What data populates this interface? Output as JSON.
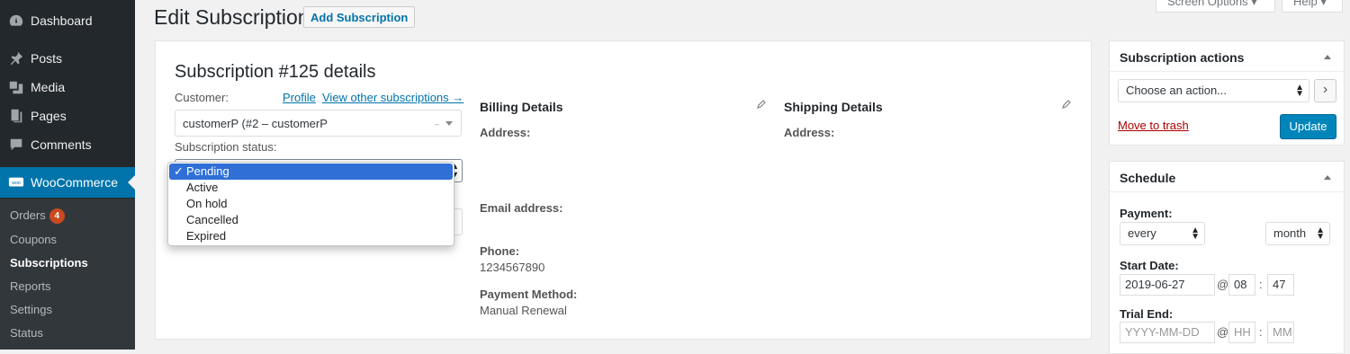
{
  "sidebar": {
    "items": [
      {
        "label": "Dashboard",
        "icon": "dashboard-icon"
      },
      {
        "label": "Posts",
        "icon": "pin-icon"
      },
      {
        "label": "Media",
        "icon": "media-icon"
      },
      {
        "label": "Pages",
        "icon": "pages-icon"
      },
      {
        "label": "Comments",
        "icon": "comments-icon"
      },
      {
        "label": "WooCommerce",
        "icon": "woocommerce-icon"
      }
    ],
    "submenu": [
      {
        "label": "Orders",
        "badge": "4"
      },
      {
        "label": "Coupons"
      },
      {
        "label": "Subscriptions"
      },
      {
        "label": "Reports"
      },
      {
        "label": "Settings"
      },
      {
        "label": "Status"
      }
    ]
  },
  "header": {
    "title": "Edit Subscription",
    "add_button": "Add Subscription",
    "screen_options": "Screen Options ▾",
    "help": "Help ▾"
  },
  "details": {
    "title": "Subscription #125 details",
    "customer_label": "Customer:",
    "profile_link": "Profile",
    "view_other_link": "View other subscriptions →",
    "customer_value": "customerP (#2 – customerP",
    "customer_trail": "–",
    "status_label": "Subscription status:",
    "status_options": [
      "Pending",
      "Active",
      "On hold",
      "Cancelled",
      "Expired"
    ],
    "status_selected": "Pending"
  },
  "billing": {
    "heading": "Billing Details",
    "address_label": "Address:",
    "email_label": "Email address:",
    "phone_label": "Phone:",
    "phone_value": "1234567890",
    "payment_label": "Payment Method:",
    "payment_value": "Manual Renewal"
  },
  "shipping": {
    "heading": "Shipping Details",
    "address_label": "Address:"
  },
  "actions_box": {
    "title": "Subscription actions",
    "select_value": "Choose an action...",
    "go_glyph": "›",
    "trash_link": "Move to trash",
    "update_button": "Update"
  },
  "schedule_box": {
    "title": "Schedule",
    "payment_label": "Payment:",
    "interval_value": "every",
    "period_value": "month",
    "start_label": "Start Date:",
    "start_date": "2019-06-27",
    "start_hour": "08",
    "start_minute": "47",
    "trial_label": "Trial End:",
    "trial_date_placeholder": "YYYY-MM-DD",
    "trial_hour_placeholder": "HH",
    "trial_minute_placeholder": "MM",
    "at_sep": "@",
    "colon_sep": ":"
  },
  "colors": {
    "accent": "#0073aa",
    "sidebar_bg": "#23282d",
    "selected_option": "#2f6fd6",
    "badge": "#ca4a1f"
  }
}
